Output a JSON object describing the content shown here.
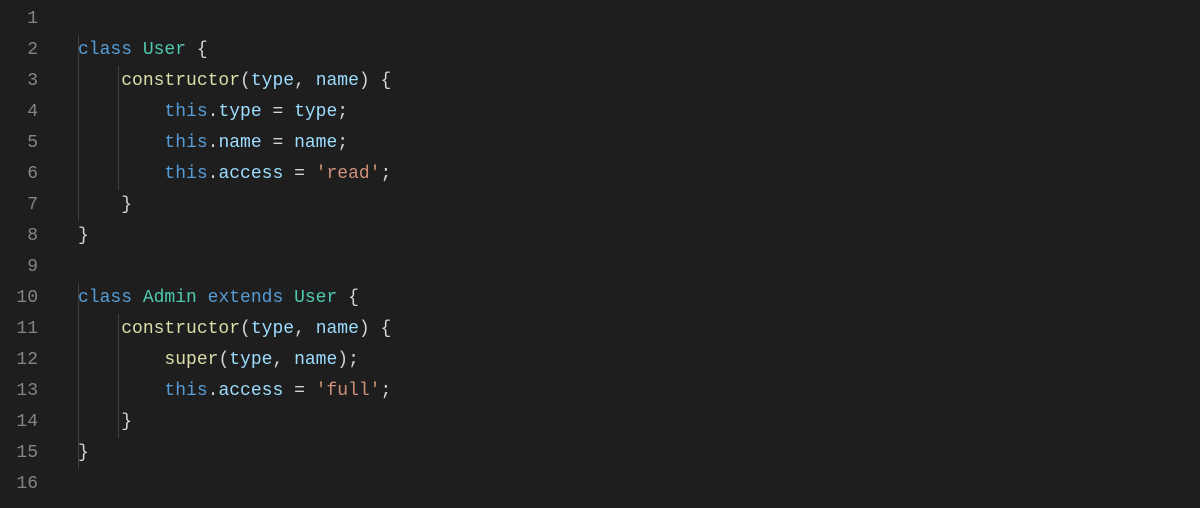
{
  "editor": {
    "lineCount": 16,
    "lines": {
      "1": [],
      "2": [
        {
          "t": "class ",
          "c": "tok-keyword"
        },
        {
          "t": "User",
          "c": "tok-class"
        },
        {
          "t": " {",
          "c": "tok-punc"
        }
      ],
      "3": [
        {
          "t": "    ",
          "c": ""
        },
        {
          "t": "constructor",
          "c": "tok-func"
        },
        {
          "t": "(",
          "c": "tok-punc"
        },
        {
          "t": "type",
          "c": "tok-param"
        },
        {
          "t": ", ",
          "c": "tok-punc"
        },
        {
          "t": "name",
          "c": "tok-param"
        },
        {
          "t": ") {",
          "c": "tok-punc"
        }
      ],
      "4": [
        {
          "t": "        ",
          "c": ""
        },
        {
          "t": "this",
          "c": "tok-this"
        },
        {
          "t": ".",
          "c": "tok-punc"
        },
        {
          "t": "type",
          "c": "tok-prop"
        },
        {
          "t": " = ",
          "c": "tok-op"
        },
        {
          "t": "type",
          "c": "tok-param"
        },
        {
          "t": ";",
          "c": "tok-punc"
        }
      ],
      "5": [
        {
          "t": "        ",
          "c": ""
        },
        {
          "t": "this",
          "c": "tok-this"
        },
        {
          "t": ".",
          "c": "tok-punc"
        },
        {
          "t": "name",
          "c": "tok-prop"
        },
        {
          "t": " = ",
          "c": "tok-op"
        },
        {
          "t": "name",
          "c": "tok-param"
        },
        {
          "t": ";",
          "c": "tok-punc"
        }
      ],
      "6": [
        {
          "t": "        ",
          "c": ""
        },
        {
          "t": "this",
          "c": "tok-this"
        },
        {
          "t": ".",
          "c": "tok-punc"
        },
        {
          "t": "access",
          "c": "tok-prop"
        },
        {
          "t": " = ",
          "c": "tok-op"
        },
        {
          "t": "'read'",
          "c": "tok-str"
        },
        {
          "t": ";",
          "c": "tok-punc"
        }
      ],
      "7": [
        {
          "t": "    }",
          "c": "tok-punc"
        }
      ],
      "8": [
        {
          "t": "}",
          "c": "tok-punc"
        }
      ],
      "9": [],
      "10": [
        {
          "t": "class ",
          "c": "tok-keyword"
        },
        {
          "t": "Admin",
          "c": "tok-class"
        },
        {
          "t": " ",
          "c": ""
        },
        {
          "t": "extends",
          "c": "tok-keyword"
        },
        {
          "t": " ",
          "c": ""
        },
        {
          "t": "User",
          "c": "tok-class"
        },
        {
          "t": " {",
          "c": "tok-punc"
        }
      ],
      "11": [
        {
          "t": "    ",
          "c": ""
        },
        {
          "t": "constructor",
          "c": "tok-func"
        },
        {
          "t": "(",
          "c": "tok-punc"
        },
        {
          "t": "type",
          "c": "tok-param"
        },
        {
          "t": ", ",
          "c": "tok-punc"
        },
        {
          "t": "name",
          "c": "tok-param"
        },
        {
          "t": ") {",
          "c": "tok-punc"
        }
      ],
      "12": [
        {
          "t": "        ",
          "c": ""
        },
        {
          "t": "super",
          "c": "tok-func"
        },
        {
          "t": "(",
          "c": "tok-punc"
        },
        {
          "t": "type",
          "c": "tok-param"
        },
        {
          "t": ", ",
          "c": "tok-punc"
        },
        {
          "t": "name",
          "c": "tok-param"
        },
        {
          "t": ");",
          "c": "tok-punc"
        }
      ],
      "13": [
        {
          "t": "        ",
          "c": ""
        },
        {
          "t": "this",
          "c": "tok-this"
        },
        {
          "t": ".",
          "c": "tok-punc"
        },
        {
          "t": "access",
          "c": "tok-prop"
        },
        {
          "t": " = ",
          "c": "tok-op"
        },
        {
          "t": "'full'",
          "c": "tok-str"
        },
        {
          "t": ";",
          "c": "tok-punc"
        }
      ],
      "14": [
        {
          "t": "    }",
          "c": "tok-punc"
        }
      ],
      "15": [
        {
          "t": "}",
          "c": "tok-punc"
        }
      ],
      "16": []
    }
  }
}
